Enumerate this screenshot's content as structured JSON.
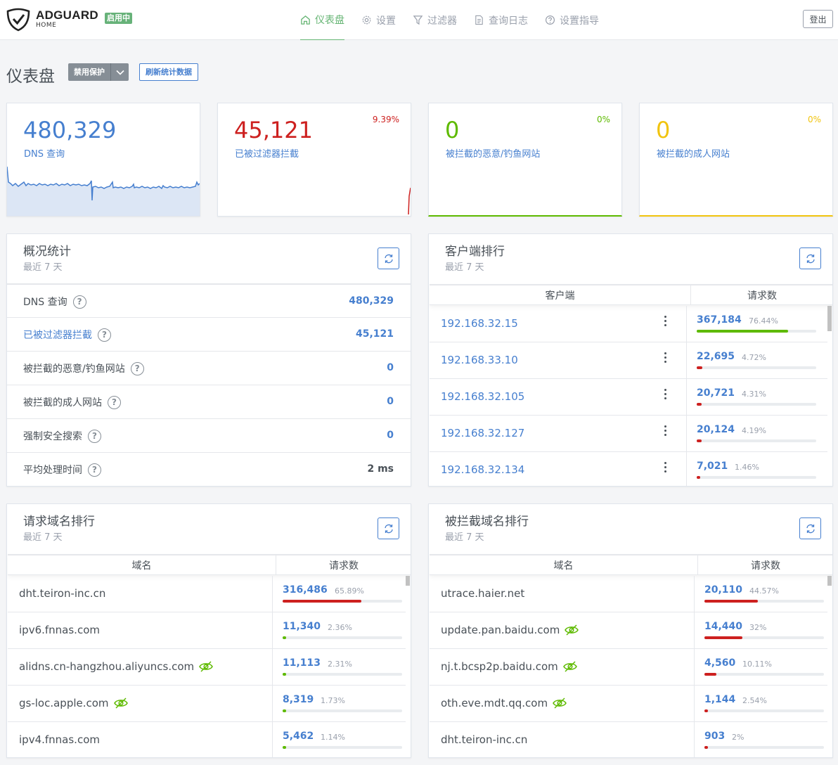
{
  "header": {
    "brand_name": "ADGUARD",
    "brand_sub": "HOME",
    "status_badge": "启用中",
    "nav": [
      {
        "label": "仪表盘",
        "icon": "home-icon",
        "active": true
      },
      {
        "label": "设置",
        "icon": "gear-icon",
        "active": false
      },
      {
        "label": "过滤器",
        "icon": "filter-icon",
        "active": false
      },
      {
        "label": "查询日志",
        "icon": "document-icon",
        "active": false
      },
      {
        "label": "设置指导",
        "icon": "help-circle-icon",
        "active": false
      }
    ],
    "logout_label": "登出"
  },
  "title_row": {
    "title": "仪表盘",
    "disable_label": "禁用保护",
    "refresh_label": "刷新统计数据"
  },
  "stats": [
    {
      "value": "480,329",
      "label": "DNS 查询",
      "pct": "",
      "color": "#467fcf"
    },
    {
      "value": "45,121",
      "label": "已被过滤器拦截",
      "pct": "9.39%",
      "color": "#cd201f"
    },
    {
      "value": "0",
      "label": "被拦截的恶意/钓鱼网站",
      "pct": "0%",
      "color": "#5eba00"
    },
    {
      "value": "0",
      "label": "被拦截的成人网站",
      "pct": "0%",
      "color": "#f1c40f"
    }
  ],
  "overview": {
    "title": "概况统计",
    "subtitle": "最近 7 天",
    "rows": [
      {
        "label": "DNS 查询",
        "value": "480,329"
      },
      {
        "label": "已被过滤器拦截",
        "value": "45,121"
      },
      {
        "label": "被拦截的恶意/钓鱼网站",
        "value": "0"
      },
      {
        "label": "被拦截的成人网站",
        "value": "0"
      },
      {
        "label": "强制安全搜索",
        "value": "0"
      },
      {
        "label": "平均处理时间",
        "value": "2 ms"
      }
    ]
  },
  "clients": {
    "title": "客户端排行",
    "subtitle": "最近 7 天",
    "col1": "客户端",
    "col2": "请求数",
    "rows": [
      {
        "name": "192.168.32.15",
        "count": "367,184",
        "pct": "76.44%",
        "fill": 0.7644,
        "color": "#5eba00"
      },
      {
        "name": "192.168.33.10",
        "count": "22,695",
        "pct": "4.72%",
        "fill": 0.0472,
        "color": "#cd201f"
      },
      {
        "name": "192.168.32.105",
        "count": "20,721",
        "pct": "4.31%",
        "fill": 0.0431,
        "color": "#cd201f"
      },
      {
        "name": "192.168.32.127",
        "count": "20,124",
        "pct": "4.19%",
        "fill": 0.0419,
        "color": "#cd201f"
      },
      {
        "name": "192.168.32.134",
        "count": "7,021",
        "pct": "1.46%",
        "fill": 0.0146,
        "color": "#cd201f"
      }
    ]
  },
  "top_domains": {
    "title": "请求域名排行",
    "subtitle": "最近 7 天",
    "col1": "域名",
    "col2": "请求数",
    "rows": [
      {
        "name": "dht.teiron-inc.cn",
        "count": "316,486",
        "pct": "65.89%",
        "fill": 0.6589,
        "color": "#cd201f",
        "eye": false
      },
      {
        "name": "ipv6.fnnas.com",
        "count": "11,340",
        "pct": "2.36%",
        "fill": 0.0236,
        "color": "#5eba00",
        "eye": false
      },
      {
        "name": "alidns.cn-hangzhou.aliyuncs.com",
        "count": "11,113",
        "pct": "2.31%",
        "fill": 0.0231,
        "color": "#5eba00",
        "eye": true
      },
      {
        "name": "gs-loc.apple.com",
        "count": "8,319",
        "pct": "1.73%",
        "fill": 0.0173,
        "color": "#5eba00",
        "eye": true
      },
      {
        "name": "ipv4.fnnas.com",
        "count": "5,462",
        "pct": "1.14%",
        "fill": 0.0114,
        "color": "#5eba00",
        "eye": false
      }
    ]
  },
  "blocked_domains": {
    "title": "被拦截域名排行",
    "subtitle": "最近 7 天",
    "col1": "域名",
    "col2": "请求数",
    "rows": [
      {
        "name": "utrace.haier.net",
        "count": "20,110",
        "pct": "44.57%",
        "fill": 0.4457,
        "color": "#cd201f",
        "eye": false
      },
      {
        "name": "update.pan.baidu.com",
        "count": "14,440",
        "pct": "32%",
        "fill": 0.32,
        "color": "#cd201f",
        "eye": true
      },
      {
        "name": "nj.t.bcsp2p.baidu.com",
        "count": "4,560",
        "pct": "10.11%",
        "fill": 0.1011,
        "color": "#cd201f",
        "eye": true
      },
      {
        "name": "oth.eve.mdt.qq.com",
        "count": "1,144",
        "pct": "2.54%",
        "fill": 0.0254,
        "color": "#cd201f",
        "eye": true
      },
      {
        "name": "dht.teiron-inc.cn",
        "count": "903",
        "pct": "2%",
        "fill": 0.02,
        "color": "#cd201f",
        "eye": false
      }
    ]
  }
}
